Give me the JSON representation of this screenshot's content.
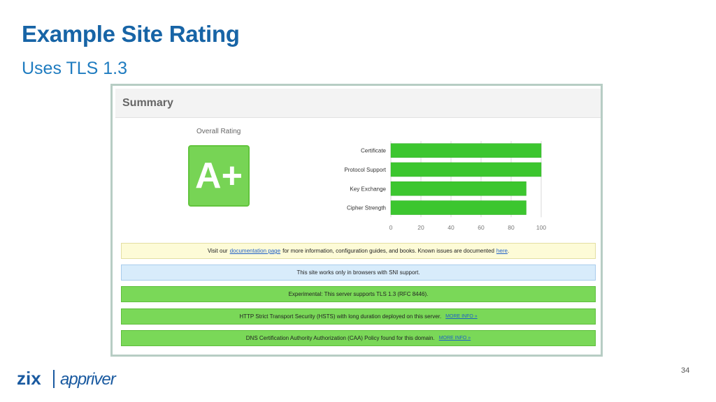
{
  "slide": {
    "title": "Example Site Rating",
    "subtitle": "Uses TLS 1.3",
    "page_number": "34",
    "logo_text_left": "zix",
    "logo_text_right": "appriver"
  },
  "summary": {
    "header": "Summary",
    "overall_label": "Overall Rating",
    "grade": "A+"
  },
  "chart_data": {
    "type": "bar",
    "orientation": "horizontal",
    "categories": [
      "Certificate",
      "Protocol Support",
      "Key Exchange",
      "Cipher Strength"
    ],
    "values": [
      100,
      100,
      90,
      90
    ],
    "xlim": [
      0,
      100
    ],
    "xticks": [
      "0",
      "20",
      "40",
      "60",
      "80",
      "100"
    ],
    "grid": true,
    "bar_color": "#3cc62f"
  },
  "banners": {
    "docs": {
      "pre": "Visit our",
      "link1": "documentation page",
      "mid": "for more information, configuration guides, and books. Known issues are documented",
      "link2": "here",
      "end": "."
    },
    "sni": "This site works only in browsers with SNI support.",
    "tls13": "Experimental: This server supports TLS 1.3 (RFC 8446).",
    "hsts": "HTTP Strict Transport Security (HSTS) with long duration deployed on this server.",
    "hsts_more": "MORE INFO »",
    "caa": "DNS Certification Authority Authorization (CAA) Policy found for this domain.",
    "caa_more": "MORE INFO »"
  },
  "colors": {
    "title": "#1764a6",
    "grade_bg": "#77d455",
    "bar": "#3cc62f",
    "banner_green": "#7ad858",
    "banner_blue": "#d8ecfb",
    "banner_yellow": "#fdfbd7"
  }
}
